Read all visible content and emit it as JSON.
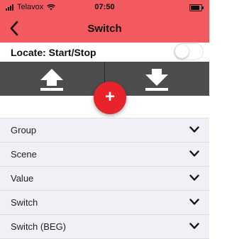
{
  "status_bar": {
    "carrier": "Telavox",
    "time": "07:50"
  },
  "header": {
    "title": "Switch",
    "back_icon": "chevron-left-icon",
    "color": "#f25a5f"
  },
  "locate": {
    "label": "Locate: Start/Stop",
    "enabled": false
  },
  "controls": {
    "up_icon": "upload-arrow-icon",
    "down_icon": "download-arrow-icon",
    "add_label": "+",
    "add_color": "#e8232b"
  },
  "list": {
    "items": [
      {
        "label": "Group"
      },
      {
        "label": "Scene"
      },
      {
        "label": "Value"
      },
      {
        "label": "Switch"
      },
      {
        "label": "Switch (BEG)"
      }
    ]
  }
}
